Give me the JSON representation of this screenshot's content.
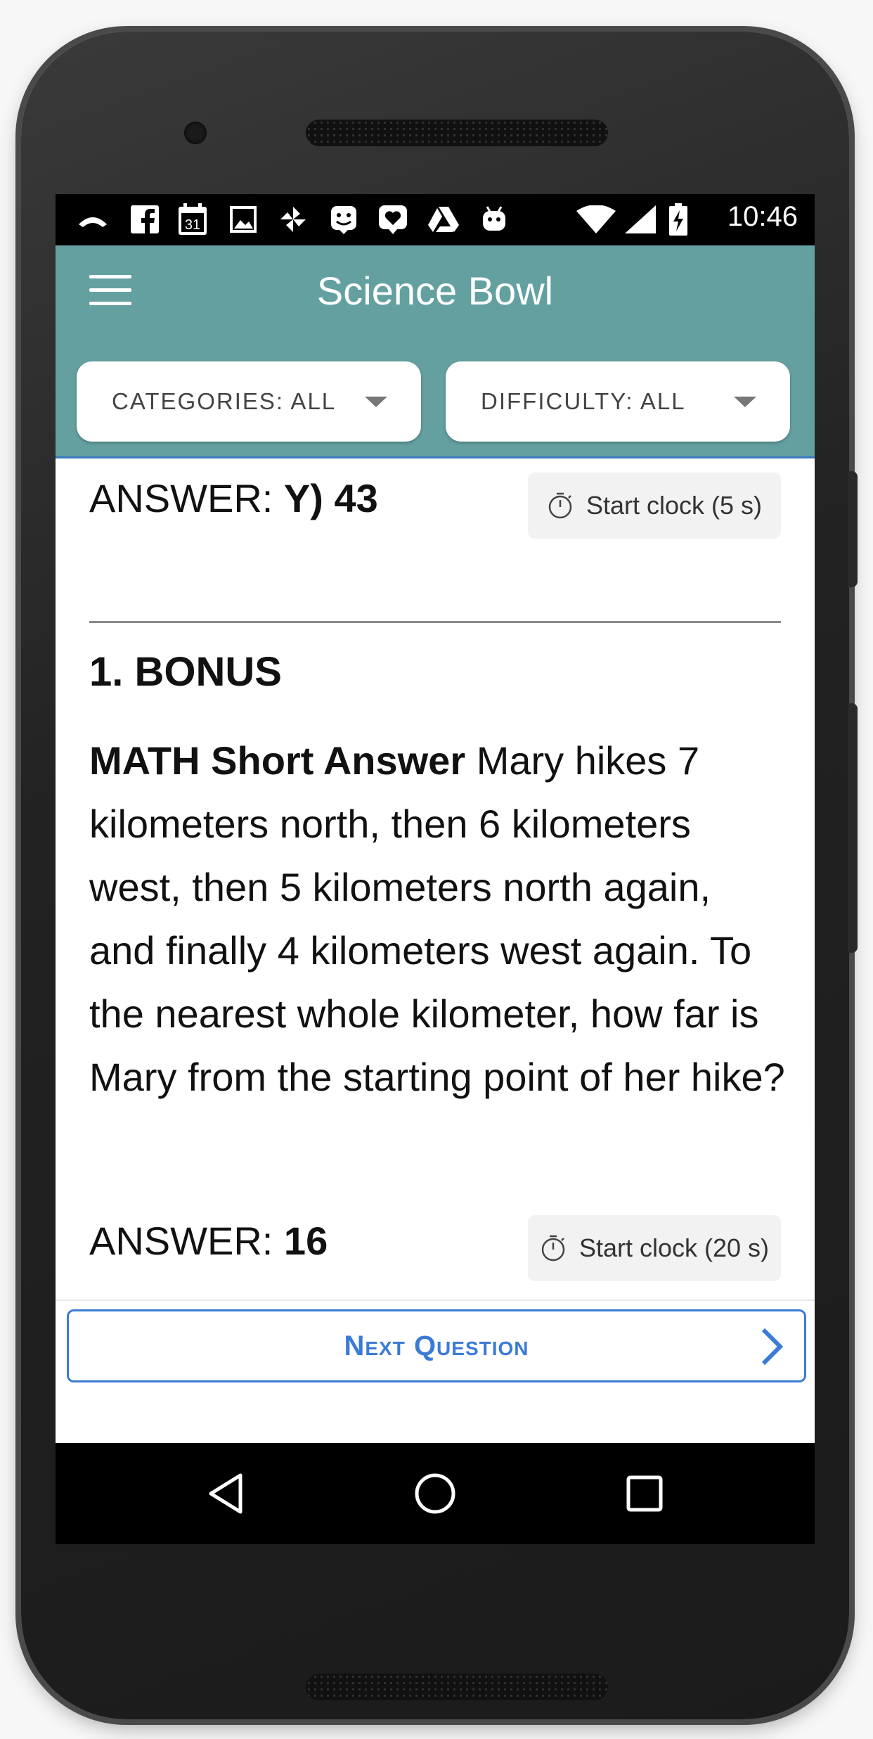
{
  "status_bar": {
    "time": "10:46",
    "calendar_day": "31",
    "left_icons": [
      "missed-call-icon",
      "facebook-icon",
      "calendar-icon",
      "image-icon",
      "pinwheel-icon",
      "mascot-icon",
      "heart-icon",
      "drive-icon",
      "android-icon"
    ],
    "right_icons": [
      "wifi-icon",
      "cell-signal-icon",
      "battery-charging-icon"
    ]
  },
  "app_bar": {
    "title": "Science Bowl",
    "categories_dropdown": "CATEGORIES: ALL",
    "difficulty_dropdown": "DIFFICULTY: ALL"
  },
  "toss_up": {
    "answer_label": "ANSWER:",
    "answer_value": "Y) 43",
    "clock_button": "Start clock (5 s)"
  },
  "bonus": {
    "title": "1. BONUS",
    "category": "MATH Short Answer",
    "question": "Mary hikes 7 kilometers north, then 6 kilometers west, then 5 kilometers north again, and finally 4 kilometers west again. To the nearest whole kilometer, how far is Mary from the starting point of her hike?",
    "answer_label": "ANSWER:",
    "answer_value": "16",
    "clock_button": "Start clock (20 s)"
  },
  "next_button": "Next Question",
  "nav_bar": [
    "back-triangle-icon",
    "home-circle-icon",
    "recents-square-icon"
  ],
  "colors": {
    "app_bar": "#64a0a0",
    "accent": "#3b7bd6"
  }
}
